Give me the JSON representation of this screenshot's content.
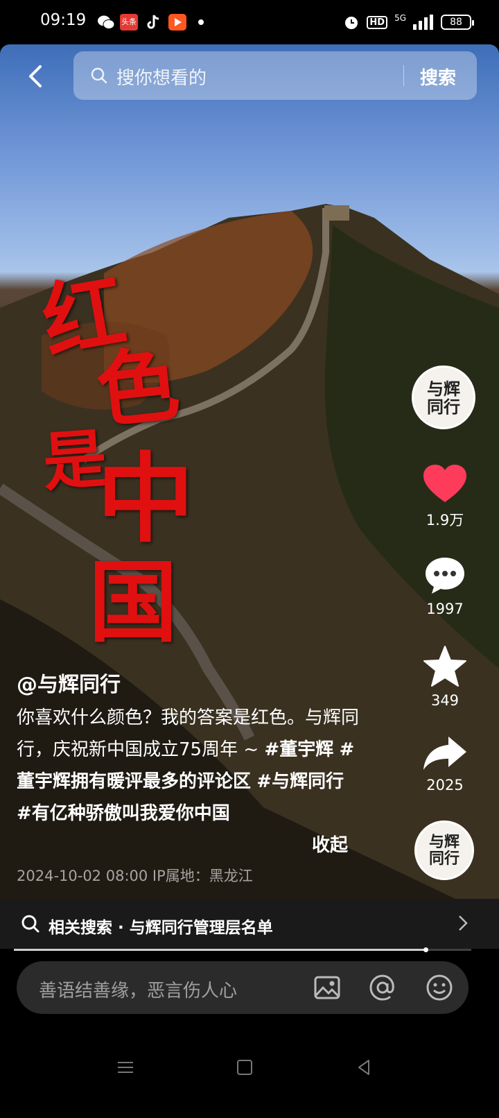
{
  "status_bar": {
    "time": "09:19",
    "toutiao_label": "头条",
    "network": "5G",
    "hd": "HD",
    "battery": "88"
  },
  "search": {
    "placeholder": "搜你想看的",
    "button_label": "搜索"
  },
  "video_title_chars": [
    "红",
    "色",
    "是",
    "中",
    "国"
  ],
  "author_avatar": {
    "line1": "与辉",
    "line2": "同行"
  },
  "actions": {
    "like_count": "1.9万",
    "comment_count": "1997",
    "favorite_count": "349",
    "share_count": "2025"
  },
  "caption": {
    "author": "@与辉同行",
    "text_plain": "你喜欢什么颜色？我的答案是红色。与辉同行，庆祝新中国成立75周年 ~ ",
    "tags": [
      "#董宇辉",
      "#董宇辉拥有暖评最多的评论区",
      "#与辉同行",
      "#有亿种骄傲叫我爱你中国"
    ],
    "collapse_label": "收起",
    "meta": "2024-10-02 08:00  IP属地：黑龙江"
  },
  "related": {
    "text": "相关搜索 · 与辉同行管理层名单"
  },
  "progress": {
    "fraction": 0.9
  },
  "comment_input": {
    "placeholder": "善语结善缘，恶言伤人心"
  },
  "colors": {
    "calligraphy": "#e01010",
    "like": "#ff3b5c",
    "bar_bg": "#2b2b2b"
  },
  "icons": [
    "back-arrow-icon",
    "search-icon",
    "heart-icon",
    "comment-icon",
    "star-icon",
    "share-icon",
    "image-icon",
    "at-icon",
    "emoji-icon",
    "chevron-right-icon"
  ]
}
